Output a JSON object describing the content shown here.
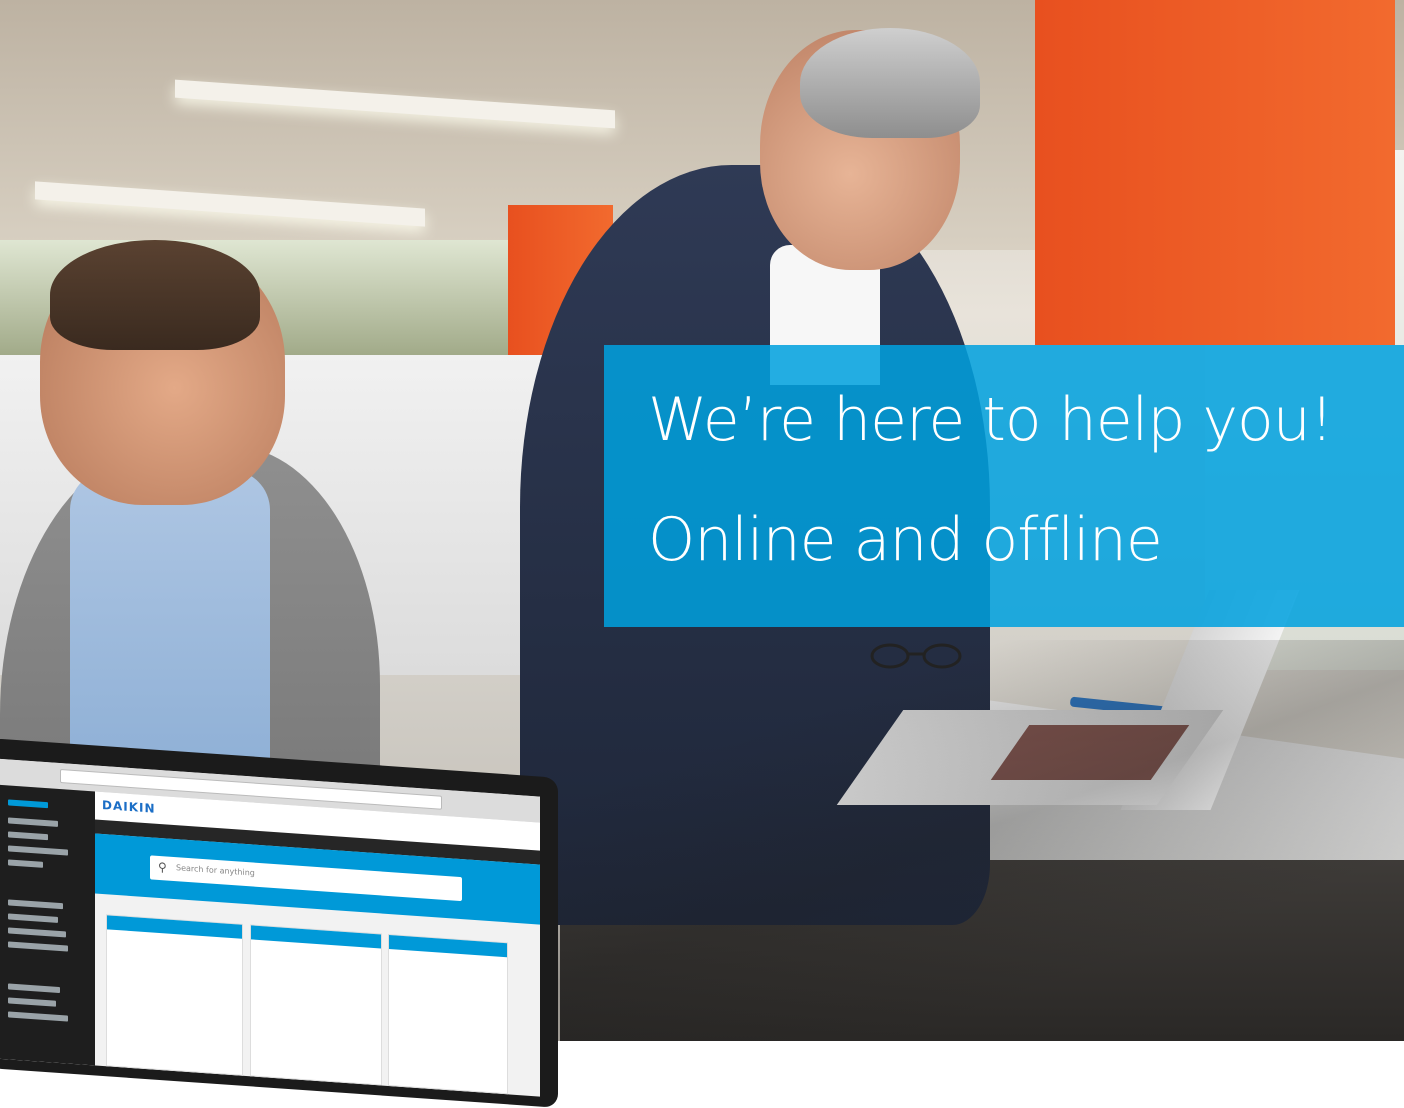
{
  "banner": {
    "headline": "We’re here to help you!",
    "subline": "Online and offline",
    "color": "#00A1DE"
  },
  "laptop_ui": {
    "brand_logo": "DAIKIN",
    "search_placeholder": "Search for anything",
    "accent_color": "#0099D8"
  }
}
